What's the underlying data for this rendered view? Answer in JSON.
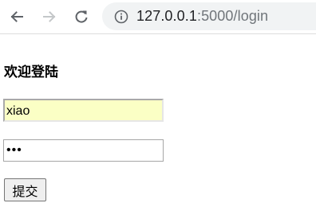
{
  "browser": {
    "url_host": "127.0.0.1",
    "url_rest": ":5000/login"
  },
  "form": {
    "title": "欢迎登陆",
    "username_value": "xiao",
    "password_value": "•••",
    "submit_label": "提交"
  },
  "colors": {
    "omnibox_bg": "#f1f3f4",
    "autofill_bg": "#fbffc5",
    "button_bg": "#efefef"
  }
}
